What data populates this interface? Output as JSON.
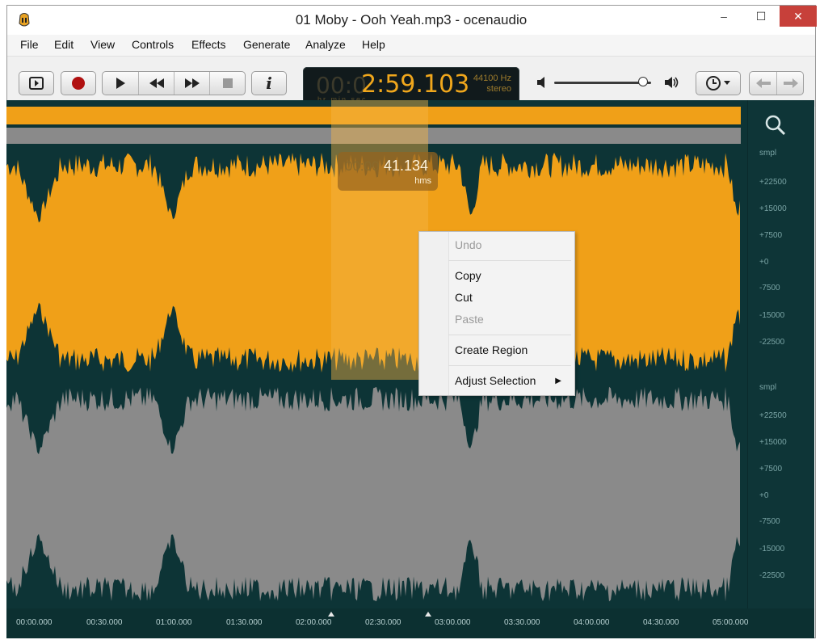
{
  "window": {
    "title": "01  Moby - Ooh Yeah.mp3 - ocenaudio",
    "minimize": "‒",
    "maximize": "☐",
    "close": "✕"
  },
  "menu": [
    "File",
    "Edit",
    "View",
    "Controls",
    "Effects",
    "Generate",
    "Analyze",
    "Help"
  ],
  "toolbar": {
    "icons": [
      "play-selection-icon",
      "record-icon",
      "play-icon",
      "rewind-icon",
      "fast-forward-icon",
      "stop-icon",
      "info-icon",
      "volume-low-icon",
      "volume-high-icon",
      "clock-icon",
      "back-arrow-icon",
      "forward-arrow-icon"
    ],
    "display": {
      "time_dim": "00:0",
      "time": "2:59.103",
      "rate": "44100 Hz",
      "channels": "stereo",
      "units": "hr   min sec"
    },
    "volume_level": 0.92
  },
  "editor": {
    "overlay_dim": "00:00",
    "overlay_value": "41.134",
    "overlay_unit": "hms",
    "amplitude_labels_top": [
      "smpl",
      "+22500",
      "+15000",
      "+7500",
      "+0",
      "-7500",
      "-15000",
      "-22500"
    ],
    "amplitude_labels_bottom": [
      "smpl",
      "+22500",
      "+15000",
      "+7500",
      "+0",
      "-7500",
      "-15000",
      "-22500"
    ],
    "timeline": [
      "00:00.000",
      "00:30.000",
      "01:00.000",
      "01:30.000",
      "02:00.000",
      "02:30.000",
      "03:00.000",
      "03:30.000",
      "04:00.000",
      "04:30.000",
      "05:00.000"
    ],
    "colors": {
      "background": "#0d3436",
      "selected_channel": "#f0a018",
      "other_channel": "#8a8a8a",
      "selection_highlight": "#f5b445"
    }
  },
  "context_menu": {
    "items": [
      {
        "label": "Undo",
        "enabled": false
      },
      {
        "label": "Copy",
        "enabled": true
      },
      {
        "label": "Cut",
        "enabled": true
      },
      {
        "label": "Paste",
        "enabled": false
      },
      {
        "label": "Create Region",
        "enabled": true
      },
      {
        "label": "Adjust Selection",
        "enabled": true,
        "submenu": true
      }
    ]
  }
}
